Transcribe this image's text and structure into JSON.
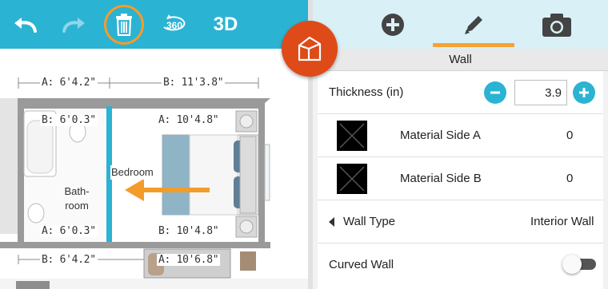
{
  "toolbar": {
    "undo_icon": "undo-arrow-icon",
    "redo_icon": "redo-arrow-icon",
    "delete_icon": "trash-icon",
    "view_360_label": "360",
    "view_3d_label": "3D"
  },
  "plan": {
    "dimensions": {
      "top_a": "A: 6'4.2\"",
      "top_b": "B: 11'3.8\"",
      "bath_top_b": "B: 6'0.3\"",
      "bed_top_a": "A: 10'4.8\"",
      "bath_bottom_a": "A: 6'0.3\"",
      "bed_bottom_b": "B: 10'4.8\"",
      "lower_b": "B: 6'4.2\"",
      "lower_a": "A: 10'6.8\""
    },
    "rooms": {
      "bedroom": "Bedroom",
      "bathroom_line1": "Bath-",
      "bathroom_line2": "room"
    }
  },
  "panel": {
    "tabs": [
      "add-icon",
      "pencil-icon",
      "camera-icon"
    ],
    "active_tab": "pencil-icon",
    "section_title": "Wall",
    "thickness_label": "Thickness (in)",
    "thickness_value": "3.9",
    "material_a_label": "Material Side A",
    "material_a_value": "0",
    "material_b_label": "Material Side B",
    "material_b_value": "0",
    "wall_type_label": "Wall Type",
    "wall_type_value": "Interior Wall",
    "curved_label": "Curved Wall",
    "curved_on": false
  },
  "colors": {
    "accent": "#2bb3d3",
    "highlight": "#f39c2a",
    "fab": "#de4a18",
    "tab_bg": "#d9f1f6"
  }
}
